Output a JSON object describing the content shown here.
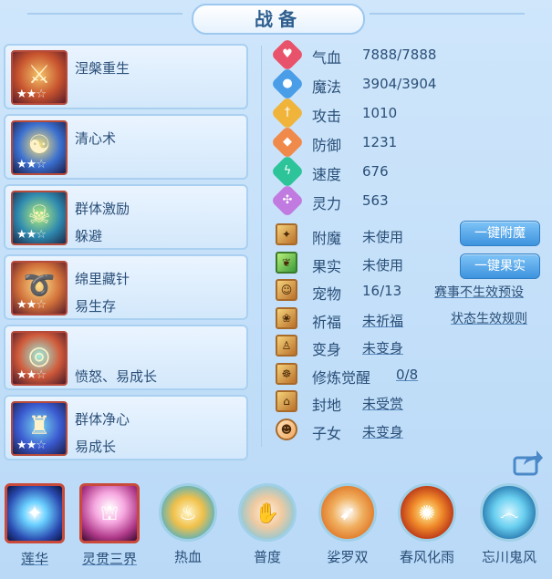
{
  "title": "战备",
  "equipment": [
    {
      "name": "涅槃重生",
      "sub": "",
      "stars_filled": 2,
      "stars_total": 3,
      "icon": "blade-icon"
    },
    {
      "name": "清心术",
      "sub": "",
      "stars_filled": 2,
      "stars_total": 3,
      "icon": "flame-mask-icon"
    },
    {
      "name": "群体激励",
      "sub": "躲避",
      "stars_filled": 2,
      "stars_total": 3,
      "icon": "demon-icon"
    },
    {
      "name": "绵里藏针",
      "sub": "易生存",
      "stars_filled": 2,
      "stars_total": 3,
      "icon": "chain-icon"
    },
    {
      "name": "",
      "sub": "愤怒、易成长",
      "stars_filled": 2,
      "stars_total": 3,
      "icon": "ring-icon"
    },
    {
      "name": "群体净心",
      "sub": "易成长",
      "stars_filled": 2,
      "stars_total": 3,
      "icon": "robe-icon"
    }
  ],
  "stats": [
    {
      "label": "气血",
      "value": "7888/7888",
      "icon": "heart-icon",
      "color": "#e8536b"
    },
    {
      "label": "魔法",
      "value": "3904/3904",
      "icon": "mana-icon",
      "color": "#4a9ee8"
    },
    {
      "label": "攻击",
      "value": "1010",
      "icon": "sword-icon",
      "color": "#f0b43a"
    },
    {
      "label": "防御",
      "value": "1231",
      "icon": "shield-icon",
      "color": "#f08a4a"
    },
    {
      "label": "速度",
      "value": "676",
      "icon": "lightning-icon",
      "color": "#2ec49a"
    },
    {
      "label": "灵力",
      "value": "563",
      "icon": "spirit-icon",
      "color": "#c07ae0"
    }
  ],
  "attributes": [
    {
      "label": "附魔",
      "value": "未使用",
      "icon": "enchant-icon"
    },
    {
      "label": "果实",
      "value": "未使用",
      "icon": "fruit-icon"
    },
    {
      "label": "宠物",
      "value": "16/13",
      "icon": "pet-icon"
    },
    {
      "label": "祈福",
      "value": "未祈福",
      "icon": "blessing-icon"
    },
    {
      "label": "变身",
      "value": "未变身",
      "icon": "transform-icon"
    },
    {
      "label": "修炼觉醒",
      "value": "0/8",
      "icon": "cultivation-icon"
    },
    {
      "label": "封地",
      "value": "未受赏",
      "icon": "fief-icon"
    },
    {
      "label": "子女",
      "value": "未变身",
      "icon": "child-icon"
    }
  ],
  "buttons": {
    "enchant": "一键附魔",
    "fruit": "一键果实"
  },
  "links": {
    "preset": "赛事不生效预设",
    "rules": "状态生效规则"
  },
  "skills": [
    {
      "label": "莲华",
      "icon": "lotus-orb-icon"
    },
    {
      "label": "灵贯三界",
      "icon": "spirit-beam-icon"
    },
    {
      "label": "热血",
      "icon": "hot-blood-icon"
    },
    {
      "label": "普度",
      "icon": "salvation-hand-icon"
    },
    {
      "label": "娑罗双",
      "icon": "sala-icon"
    },
    {
      "label": "春风化雨",
      "icon": "spring-rain-icon"
    },
    {
      "label": "忘川鬼风",
      "icon": "ghost-wind-icon"
    }
  ]
}
